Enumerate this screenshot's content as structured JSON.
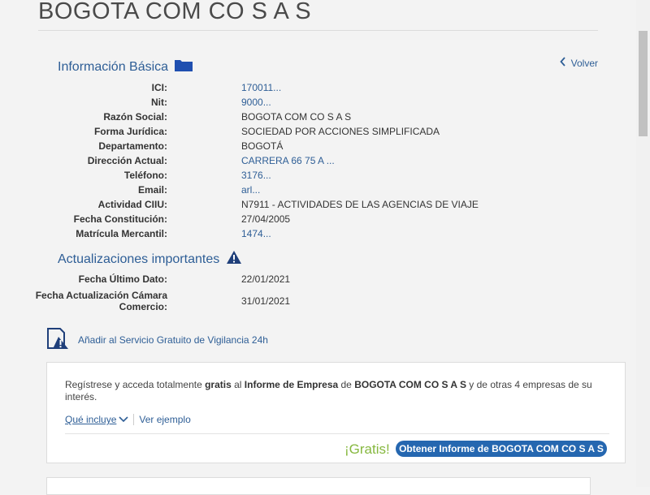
{
  "page": {
    "title": "BOGOTA COM CO S A S"
  },
  "basic_info": {
    "heading": "Información Básica",
    "back_label": "Volver",
    "rows": [
      {
        "label": "ICI:",
        "value": "170011..."
      },
      {
        "label": "Nit:",
        "value": "9000..."
      },
      {
        "label": "Razón Social:",
        "value": "BOGOTA COM CO S A S"
      },
      {
        "label": "Forma Jurídica:",
        "value": "SOCIEDAD POR ACCIONES SIMPLIFICADA"
      },
      {
        "label": "Departamento:",
        "value": "BOGOTÁ"
      },
      {
        "label": "Dirección Actual:",
        "value": "CARRERA 66 75 A ..."
      },
      {
        "label": "Teléfono:",
        "value": "3176..."
      },
      {
        "label": "Email:",
        "value": "arl..."
      },
      {
        "label": "Actividad CIIU:",
        "value": "N7911 - ACTIVIDADES DE LAS AGENCIAS DE VIAJE"
      },
      {
        "label": "Fecha Constitución:",
        "value": "27/04/2005"
      },
      {
        "label": "Matrícula Mercantil:",
        "value": "1474..."
      }
    ]
  },
  "updates": {
    "heading": "Actualizaciones importantes",
    "rows": [
      {
        "label": "Fecha Último Dato:",
        "value": "22/01/2021"
      },
      {
        "label_line1": "Fecha Actualización Cámara",
        "label_line2": "Comercio:",
        "value": "31/01/2021"
      }
    ]
  },
  "watch": {
    "label": "Añadir al Servicio Gratuito de Vigilancia 24h"
  },
  "promo": {
    "text_1": "Regístrese y acceda totalmente ",
    "text_bold_1": "gratis",
    "text_2": " al ",
    "text_bold_2": "Informe de Empresa",
    "text_3": " de ",
    "text_bold_3": "BOGOTA COM CO S A S",
    "text_4": " y de otras 4 empresas de su interés.",
    "link_includes": "Qué incluye",
    "link_example": "Ver ejemplo",
    "gratis_label": "¡Gratis!",
    "cta_label": "Obtener Informe de BOGOTA COM CO S A S"
  },
  "colors": {
    "accent": "#2e5e96",
    "button": "#2567b0",
    "gratis": "#86b83f"
  },
  "icons": {
    "basic_info": "folder-icon",
    "updates": "warning-icon",
    "watch": "document-warning-icon",
    "back": "chevron-left-icon"
  }
}
